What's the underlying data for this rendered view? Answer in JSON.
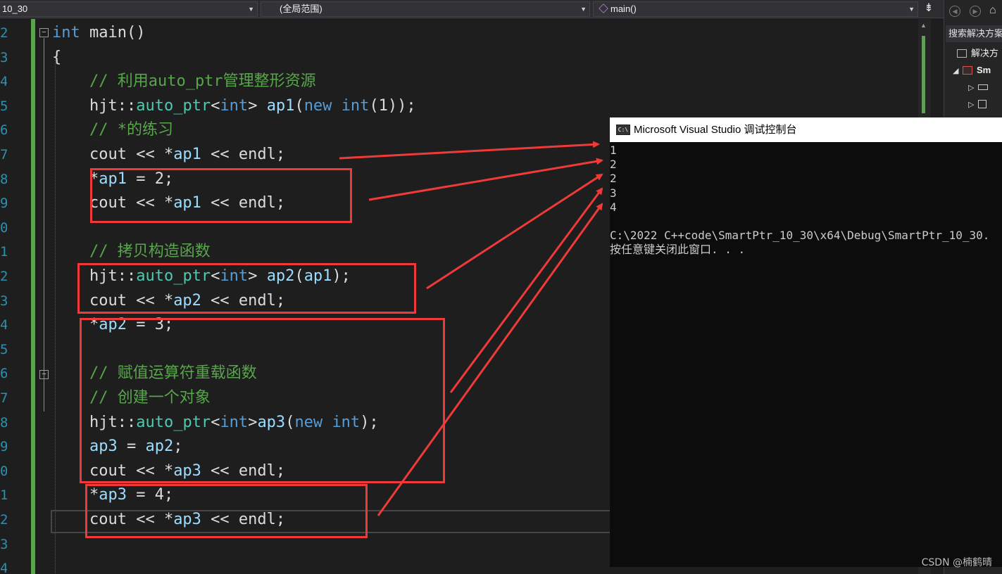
{
  "navbar": {
    "project_combo": "10_30",
    "scope_combo": "(全局范围)",
    "function_combo": "main()"
  },
  "editor": {
    "line_numbers": [
      "2",
      "3",
      "4",
      "5",
      "6",
      "7",
      "8",
      "9",
      "0",
      "1",
      "2",
      "3",
      "4",
      "5",
      "6",
      "7",
      "8",
      "9",
      "0",
      "1",
      "2",
      "3",
      "4"
    ],
    "lines": [
      {
        "tokens": [
          {
            "t": "int",
            "c": "kw"
          },
          {
            "t": " main()",
            "c": ""
          }
        ]
      },
      {
        "tokens": [
          {
            "t": "{",
            "c": ""
          }
        ]
      },
      {
        "tokens": [
          {
            "t": "    // 利用auto_ptr管理整形资源",
            "c": "cm"
          }
        ]
      },
      {
        "tokens": [
          {
            "t": "    hjt::",
            "c": ""
          },
          {
            "t": "auto_ptr",
            "c": "ty"
          },
          {
            "t": "<",
            "c": ""
          },
          {
            "t": "int",
            "c": "kw"
          },
          {
            "t": "> ",
            "c": ""
          },
          {
            "t": "ap1",
            "c": "id"
          },
          {
            "t": "(",
            "c": ""
          },
          {
            "t": "new",
            "c": "kw"
          },
          {
            "t": " ",
            "c": ""
          },
          {
            "t": "int",
            "c": "kw"
          },
          {
            "t": "(1));",
            "c": ""
          }
        ]
      },
      {
        "tokens": [
          {
            "t": "    // *的练习",
            "c": "cm"
          }
        ]
      },
      {
        "tokens": [
          {
            "t": "    cout << *",
            "c": ""
          },
          {
            "t": "ap1",
            "c": "id"
          },
          {
            "t": " << endl;",
            "c": ""
          }
        ]
      },
      {
        "tokens": [
          {
            "t": "    *",
            "c": ""
          },
          {
            "t": "ap1",
            "c": "id"
          },
          {
            "t": " = 2;",
            "c": ""
          }
        ]
      },
      {
        "tokens": [
          {
            "t": "    cout << *",
            "c": ""
          },
          {
            "t": "ap1",
            "c": "id"
          },
          {
            "t": " << endl;",
            "c": ""
          }
        ]
      },
      {
        "tokens": []
      },
      {
        "tokens": [
          {
            "t": "    // 拷贝构造函数",
            "c": "cm"
          }
        ]
      },
      {
        "tokens": [
          {
            "t": "    hjt::",
            "c": ""
          },
          {
            "t": "auto_ptr",
            "c": "ty"
          },
          {
            "t": "<",
            "c": ""
          },
          {
            "t": "int",
            "c": "kw"
          },
          {
            "t": "> ",
            "c": ""
          },
          {
            "t": "ap2",
            "c": "id"
          },
          {
            "t": "(",
            "c": ""
          },
          {
            "t": "ap1",
            "c": "id"
          },
          {
            "t": ");",
            "c": ""
          }
        ]
      },
      {
        "tokens": [
          {
            "t": "    cout << *",
            "c": ""
          },
          {
            "t": "ap2",
            "c": "id"
          },
          {
            "t": " << endl;",
            "c": ""
          }
        ]
      },
      {
        "tokens": [
          {
            "t": "    *",
            "c": ""
          },
          {
            "t": "ap2",
            "c": "id"
          },
          {
            "t": " = 3;",
            "c": ""
          }
        ]
      },
      {
        "tokens": []
      },
      {
        "tokens": [
          {
            "t": "    // 赋值运算符重载函数",
            "c": "cm"
          }
        ]
      },
      {
        "tokens": [
          {
            "t": "    // 创建一个对象",
            "c": "cm"
          }
        ]
      },
      {
        "tokens": [
          {
            "t": "    hjt::",
            "c": ""
          },
          {
            "t": "auto_ptr",
            "c": "ty"
          },
          {
            "t": "<",
            "c": ""
          },
          {
            "t": "int",
            "c": "kw"
          },
          {
            "t": ">",
            "c": ""
          },
          {
            "t": "ap3",
            "c": "id"
          },
          {
            "t": "(",
            "c": ""
          },
          {
            "t": "new",
            "c": "kw"
          },
          {
            "t": " ",
            "c": ""
          },
          {
            "t": "int",
            "c": "kw"
          },
          {
            "t": ");",
            "c": ""
          }
        ]
      },
      {
        "tokens": [
          {
            "t": "    ",
            "c": ""
          },
          {
            "t": "ap3",
            "c": "id"
          },
          {
            "t": " = ",
            "c": ""
          },
          {
            "t": "ap2",
            "c": "id"
          },
          {
            "t": ";",
            "c": ""
          }
        ]
      },
      {
        "tokens": [
          {
            "t": "    cout << *",
            "c": ""
          },
          {
            "t": "ap3",
            "c": "id"
          },
          {
            "t": " << endl;",
            "c": ""
          }
        ]
      },
      {
        "tokens": [
          {
            "t": "    *",
            "c": ""
          },
          {
            "t": "ap3",
            "c": "id"
          },
          {
            "t": " = 4;",
            "c": ""
          }
        ]
      },
      {
        "tokens": [
          {
            "t": "    cout << *",
            "c": ""
          },
          {
            "t": "ap3",
            "c": "id"
          },
          {
            "t": " << endl;",
            "c": ""
          }
        ]
      },
      {
        "tokens": []
      },
      {
        "tokens": []
      }
    ]
  },
  "solution_explorer": {
    "search_placeholder": "搜索解决方案",
    "solution_label": "解决方",
    "project_label": "Sm",
    "refs_label": "",
    "deps_label": ""
  },
  "console": {
    "title": "Microsoft Visual Studio 调试控制台",
    "icon_text": "C:\\",
    "output": "1\n2\n2\n3\n4\n\nC:\\2022 C++code\\SmartPtr_10_30\\x64\\Debug\\SmartPtr_10_30.\n按任意键关闭此窗口. . ."
  },
  "watermark": "CSDN @楠鹤晴",
  "colors": {
    "annotation_red": "#f03a3a",
    "keyword": "#569cd6",
    "comment": "#57a64a",
    "identifier": "#9cdcfe",
    "type": "#4ec9b0"
  }
}
